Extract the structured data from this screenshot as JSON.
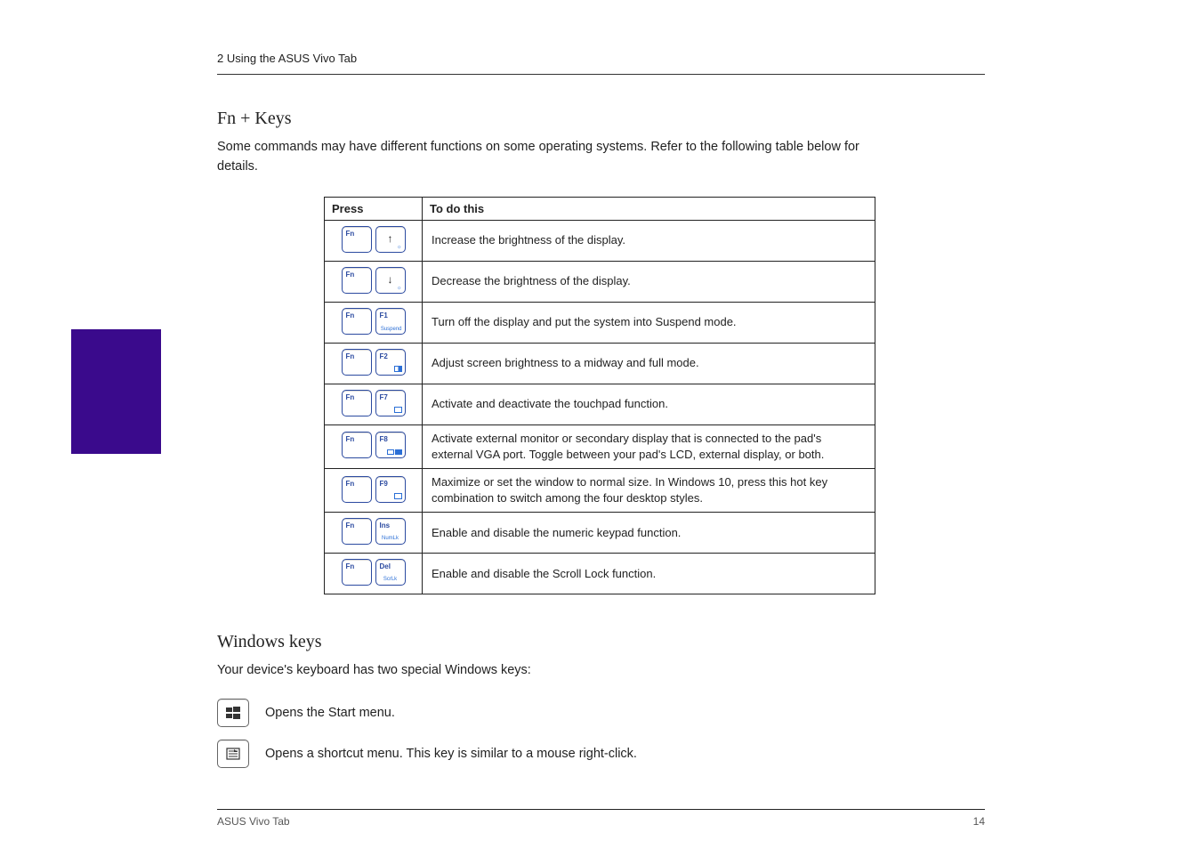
{
  "header_section": "2 Using the ASUS Vivo Tab",
  "fn_heading": "Fn + Keys",
  "fn_para": "Some commands may have different functions on some operating systems. Refer to the following table below for details.",
  "table": {
    "col1": "Press",
    "col2": "To do this",
    "rows": [
      {
        "keys": [
          "Fn",
          "↑"
        ],
        "sub": "",
        "desc": "Increase the brightness of the display."
      },
      {
        "keys": [
          "Fn",
          "↓"
        ],
        "sub": "",
        "desc": "Decrease the brightness of the display."
      },
      {
        "keys": [
          "Fn",
          "F1"
        ],
        "sub": "Suspend",
        "desc": "Turn off the display and put the system into Suspend mode."
      },
      {
        "keys": [
          "Fn",
          "F2"
        ],
        "sub": "box-half",
        "desc": "Adjust screen brightness to a midway and full mode."
      },
      {
        "keys": [
          "Fn",
          "F7"
        ],
        "sub": "box-empty",
        "desc": "Activate and deactivate the touchpad function."
      },
      {
        "keys": [
          "Fn",
          "F8"
        ],
        "sub": "two-one",
        "desc": "Activate external monitor or secondary display that is connected to the pad's external VGA port. Toggle between your pad's LCD, external display, or both."
      },
      {
        "keys": [
          "Fn",
          "F9"
        ],
        "sub": "box-empty",
        "desc": "Maximize or set the window to normal size. In Windows 10, press this hot key combination to switch among the four desktop styles."
      },
      {
        "keys": [
          "Fn",
          "Ins"
        ],
        "sub": "NumLk",
        "desc": "Enable and disable the numeric keypad function."
      },
      {
        "keys": [
          "Fn",
          "Del"
        ],
        "sub": "ScrLk",
        "desc": "Enable and disable the Scroll Lock function."
      }
    ]
  },
  "win_heading": "Windows keys",
  "win_para": "Your device's keyboard has two special Windows keys:",
  "win_key_1": "Opens the Start menu.",
  "win_key_2": "Opens a shortcut menu. This key is similar to a mouse right-click.",
  "footer_left": "ASUS Vivo Tab",
  "footer_right": "14"
}
